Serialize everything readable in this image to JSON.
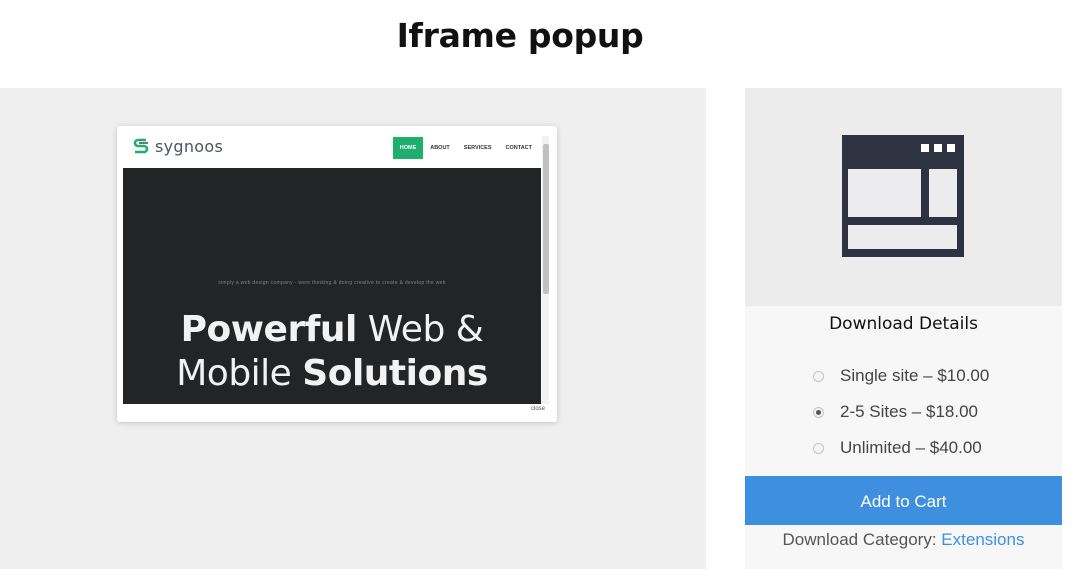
{
  "page": {
    "title": "Iframe popup"
  },
  "popup": {
    "site_logo_text": "sygnoos",
    "nav": [
      "HOME",
      "ABOUT",
      "SERVICES",
      "CONTACT"
    ],
    "nav_active_index": 0,
    "hero_tagline": "simply a web design company - were thinking & doing creative to create & develop the web",
    "hero_line1_bold": "Powerful",
    "hero_line1_rest": " Web &",
    "hero_line2_start": "Mobile ",
    "hero_line2_bold": "Solutions",
    "close_label": "close",
    "accent_color": "#1fae6e"
  },
  "sidebar": {
    "product_icon": "browser-window-icon",
    "details_heading": "Download Details",
    "price_options": [
      {
        "label": "Single site – $10.00",
        "checked": false
      },
      {
        "label": "2-5 Sites – $18.00",
        "checked": true
      },
      {
        "label": "Unlimited – $40.00",
        "checked": false
      }
    ],
    "add_to_cart_label": "Add to Cart",
    "category_prefix": "Download Category: ",
    "category_link": "Extensions",
    "button_color": "#3f8fe0"
  }
}
